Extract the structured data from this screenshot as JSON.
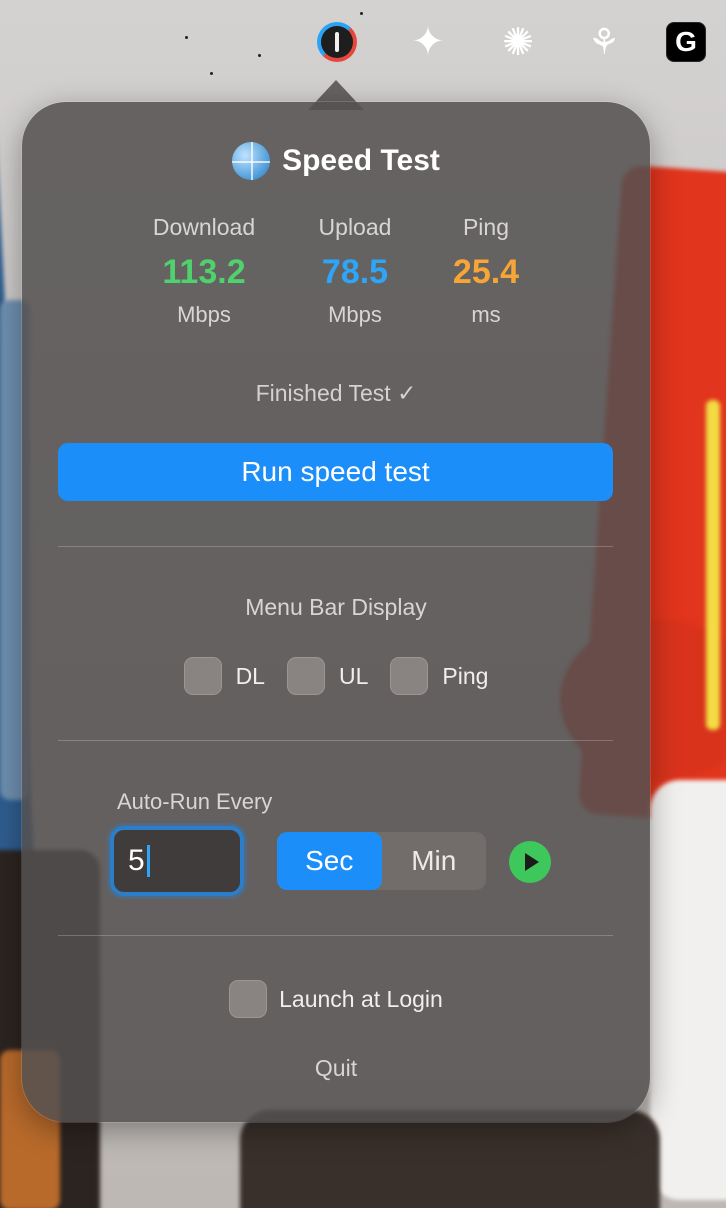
{
  "menubar": {
    "icons": [
      "speedometer-icon",
      "sparkle-icon",
      "starburst-icon",
      "tree-icon",
      "logitech-g-icon"
    ],
    "g_letter": "G"
  },
  "popover": {
    "title": "Speed Test",
    "title_icon": "globe-icon",
    "metrics": {
      "download": {
        "label": "Download",
        "value": "113.2",
        "unit": "Mbps",
        "color": "#4fd16d"
      },
      "upload": {
        "label": "Upload",
        "value": "78.5",
        "unit": "Mbps",
        "color": "#2ea5f7"
      },
      "ping": {
        "label": "Ping",
        "value": "25.4",
        "unit": "ms",
        "color": "#f5a637"
      }
    },
    "status": "Finished Test ✓",
    "run_button": "Run speed test",
    "menu_bar_display": {
      "title": "Menu Bar Display",
      "options": [
        {
          "label": "DL",
          "checked": false
        },
        {
          "label": "UL",
          "checked": false
        },
        {
          "label": "Ping",
          "checked": false
        }
      ]
    },
    "auto_run": {
      "title": "Auto-Run Every",
      "value": "5",
      "units": [
        "Sec",
        "Min"
      ],
      "selected_unit": "Sec"
    },
    "launch_at_login": {
      "label": "Launch at Login",
      "checked": false
    },
    "quit": "Quit"
  },
  "colors": {
    "accent": "#1c8ef9",
    "play": "#3ec75b"
  }
}
